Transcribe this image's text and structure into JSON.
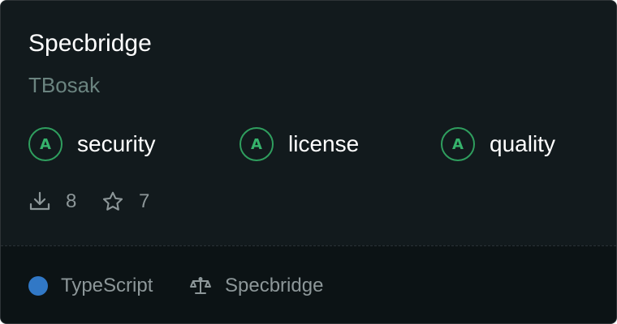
{
  "package": {
    "name": "Specbridge",
    "owner": "TBosak"
  },
  "scores": [
    {
      "grade": "A",
      "label": "security"
    },
    {
      "grade": "A",
      "label": "license"
    },
    {
      "grade": "A",
      "label": "quality"
    }
  ],
  "stats": {
    "downloads": "8",
    "stars": "7"
  },
  "footer": {
    "language": "TypeScript",
    "license": "Specbridge"
  },
  "colors": {
    "background": "#121a1d",
    "footer_background": "#0c1315",
    "grade_green": "#36b36c",
    "typescript_blue": "#3178c6",
    "muted_text": "#8d9799",
    "owner_text": "#6b8480"
  },
  "icons": {
    "downloads": "download-icon",
    "stars": "star-icon",
    "license": "scale-icon"
  }
}
